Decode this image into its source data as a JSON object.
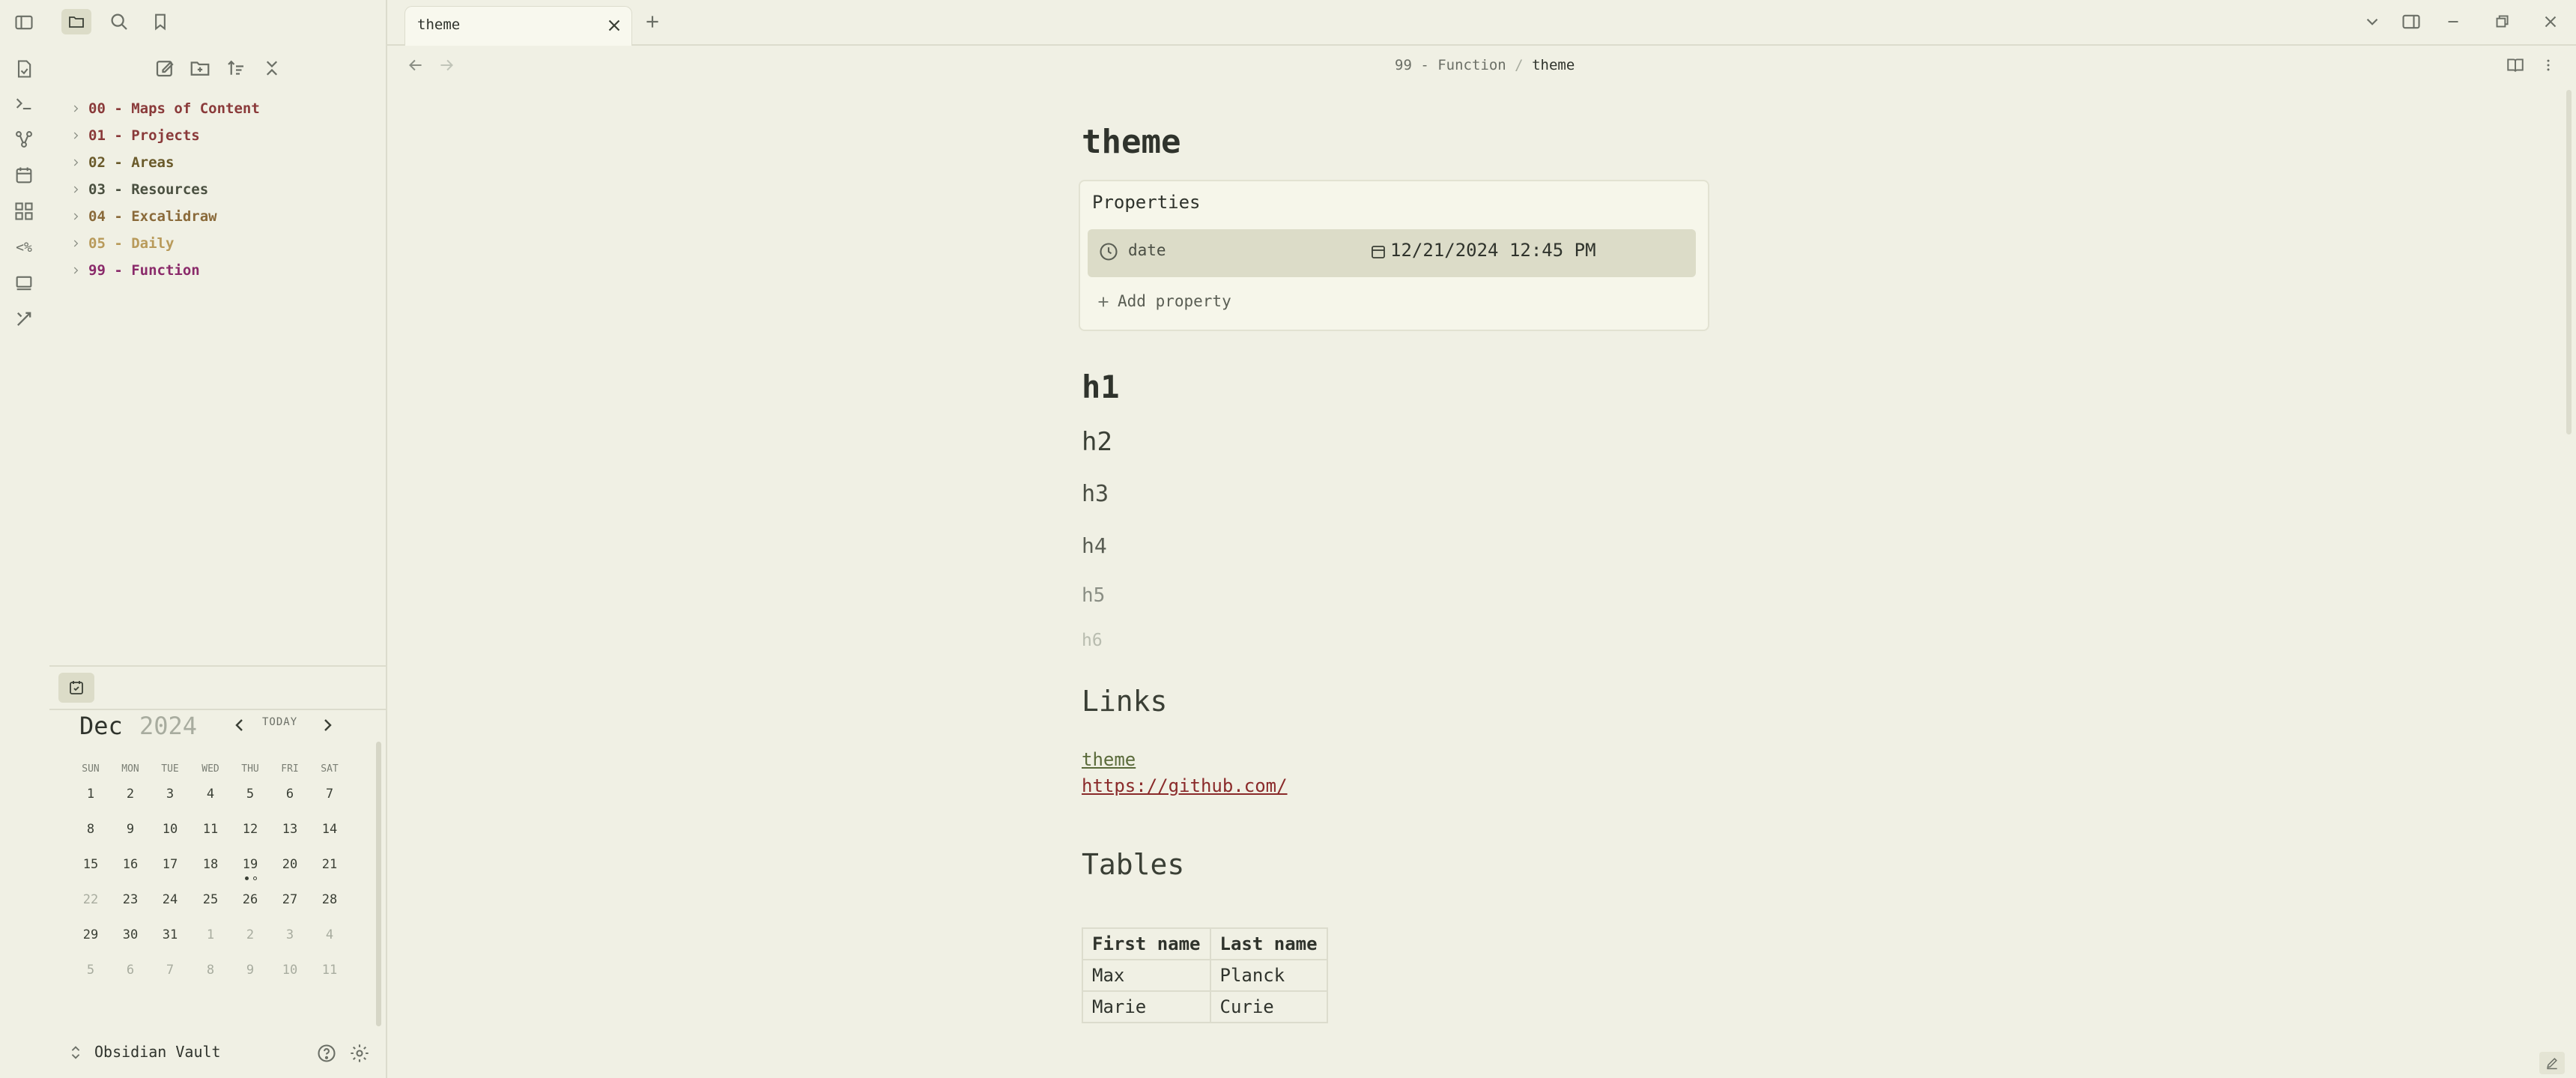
{
  "tab": {
    "title": "theme"
  },
  "breadcrumb": {
    "folder": "99 - Function",
    "sep": "/",
    "current": "theme"
  },
  "file_tree": [
    {
      "label": "00 - Maps of Content",
      "color": "#8a3a3a"
    },
    {
      "label": "01 - Projects",
      "color": "#8a3a3a"
    },
    {
      "label": "02 - Areas",
      "color": "#6a5a2a"
    },
    {
      "label": "03 - Resources",
      "color": "#4a5040"
    },
    {
      "label": "04 - Excalidraw",
      "color": "#8a6a3a"
    },
    {
      "label": "05 - Daily",
      "color": "#b89a5a"
    },
    {
      "label": "99 - Function",
      "color": "#8a2a6a"
    }
  ],
  "calendar": {
    "month": "Dec",
    "year": "2024",
    "today_label": "TODAY",
    "dow": [
      "SUN",
      "MON",
      "TUE",
      "WED",
      "THU",
      "FRI",
      "SAT"
    ],
    "weeks": [
      [
        "1",
        "2",
        "3",
        "4",
        "5",
        "6",
        "7"
      ],
      [
        "8",
        "9",
        "10",
        "11",
        "12",
        "13",
        "14"
      ],
      [
        "15",
        "16",
        "17",
        "18",
        "19",
        "20",
        "21"
      ],
      [
        "22",
        "23",
        "24",
        "25",
        "26",
        "27",
        "28"
      ],
      [
        "29",
        "30",
        "31",
        "1",
        "2",
        "3",
        "4"
      ],
      [
        "5",
        "6",
        "7",
        "8",
        "9",
        "10",
        "11"
      ]
    ]
  },
  "vault": {
    "name": "Obsidian Vault"
  },
  "doc": {
    "title": "theme",
    "properties_label": "Properties",
    "property": {
      "key": "date",
      "value": "12/21/2024 12:45 PM"
    },
    "add_property": "Add property",
    "headings": [
      "h1",
      "h2",
      "h3",
      "h4",
      "h5",
      "h6"
    ],
    "links_heading": "Links",
    "links": [
      "theme",
      "https://github.com/"
    ],
    "tables_heading": "Tables",
    "table": {
      "headers": [
        "First name",
        "Last name"
      ],
      "rows": [
        [
          "Max",
          "Planck"
        ],
        [
          "Marie",
          "Curie"
        ]
      ]
    }
  },
  "icons": {
    "ribbon": [
      "sidebar-toggle-icon",
      "files-icon",
      "search-icon",
      "bookmark-icon",
      "open-note-icon",
      "terminal-icon",
      "graph-icon",
      "calendar-icon",
      "canvas-icon",
      "templater-icon",
      "slides-icon",
      "tools-icon"
    ],
    "file_actions": [
      "new-note-icon",
      "new-folder-icon",
      "sort-icon",
      "collapse-all-icon"
    ]
  }
}
